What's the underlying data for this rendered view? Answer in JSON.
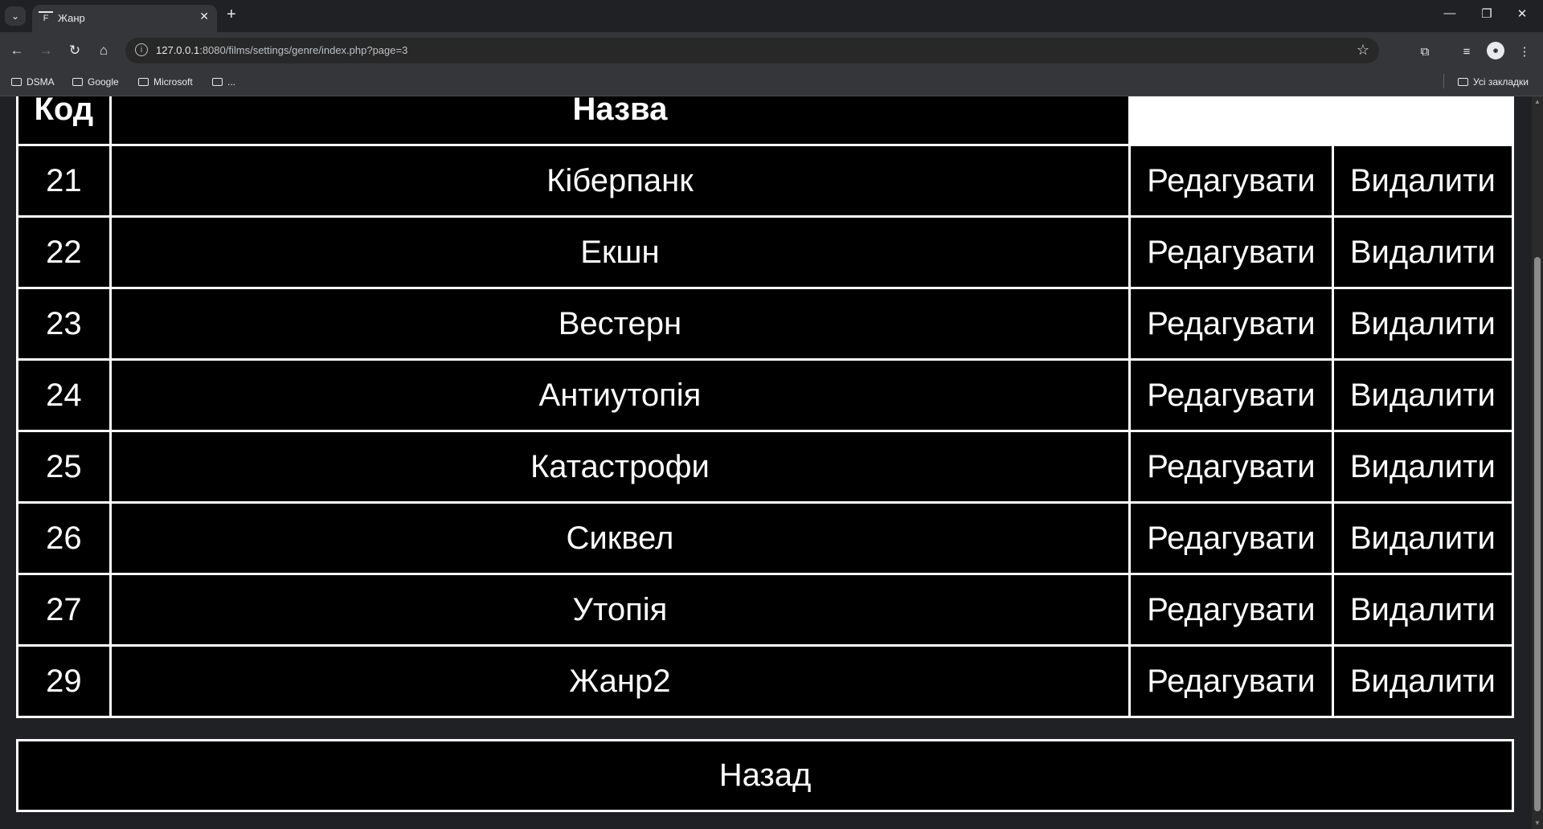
{
  "browser": {
    "tab_title": "Жанр",
    "url_host": "127.0.0.1",
    "url_rest": ":8080/films/settings/genre/index.php?page=3",
    "bookmarks": [
      "DSMA",
      "Google",
      "Microsoft",
      "..."
    ],
    "all_bookmarks": "Усі закладки"
  },
  "table": {
    "headers": {
      "code": "Код",
      "name": "Назва"
    },
    "rows": [
      {
        "code": "21",
        "name": "Кіберпанк",
        "edit": "Редагувати",
        "delete": "Видалити"
      },
      {
        "code": "22",
        "name": "Екшн",
        "edit": "Редагувати",
        "delete": "Видалити"
      },
      {
        "code": "23",
        "name": "Вестерн",
        "edit": "Редагувати",
        "delete": "Видалити"
      },
      {
        "code": "24",
        "name": "Антиутопія",
        "edit": "Редагувати",
        "delete": "Видалити"
      },
      {
        "code": "25",
        "name": "Катастрофи",
        "edit": "Редагувати",
        "delete": "Видалити"
      },
      {
        "code": "26",
        "name": "Сиквел",
        "edit": "Редагувати",
        "delete": "Видалити"
      },
      {
        "code": "27",
        "name": "Утопія",
        "edit": "Редагувати",
        "delete": "Видалити"
      },
      {
        "code": "29",
        "name": "Жанр2",
        "edit": "Редагувати",
        "delete": "Видалити"
      }
    ]
  },
  "back_label": "Назад"
}
